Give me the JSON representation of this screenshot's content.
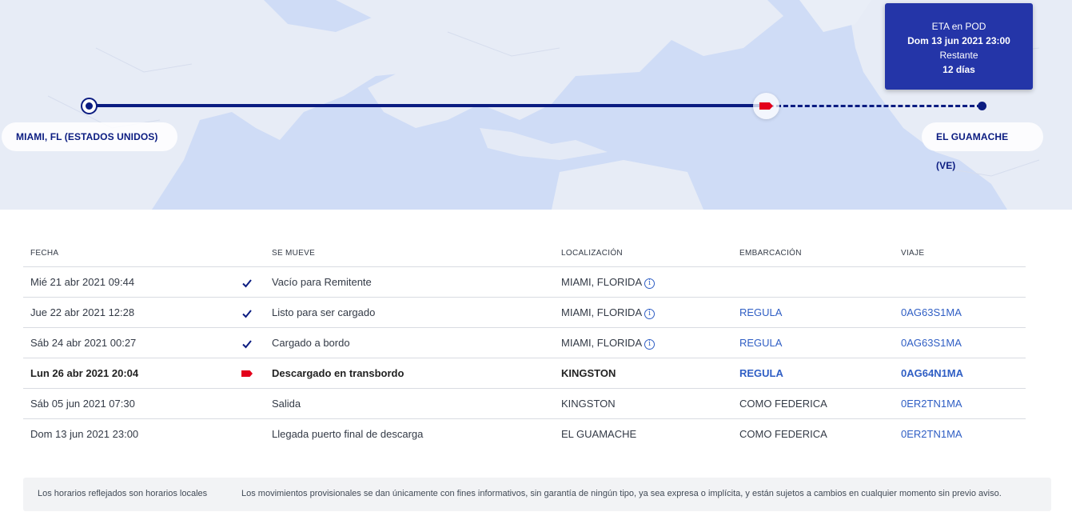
{
  "map": {
    "origin_label": "MIAMI, FL (ESTADOS UNIDOS)",
    "destination_label": "EL GUAMACHE (VE)",
    "eta": {
      "title": "ETA en POD",
      "datetime": "Dom 13 jun 2021 23:00",
      "remaining_label": "Restante",
      "remaining_value": "12 días"
    },
    "colors": {
      "route": "#0b1c81",
      "vessel": "#e3001b",
      "eta_box": "#2435a8",
      "sea": "#d3dff7"
    }
  },
  "table": {
    "headers": {
      "date": "FECHA",
      "move": "SE MUEVE",
      "location": "LOCALIZACIÓN",
      "vessel": "EMBARCACIÓN",
      "voyage": "VIAJE"
    },
    "rows": [
      {
        "date": "Mié 21 abr 2021 09:44",
        "status_icon": "check-icon",
        "move": "Vacío para Remitente",
        "location": "MIAMI, FLORIDA",
        "vessel": "",
        "voyage": ""
      },
      {
        "date": "Jue 22 abr 2021 12:28",
        "status_icon": "check-icon",
        "move": "Listo para ser cargado",
        "location": "MIAMI, FLORIDA",
        "vessel": "REGULA",
        "voyage": "0AG63S1MA"
      },
      {
        "date": "Sáb 24 abr 2021 00:27",
        "status_icon": "check-icon",
        "move": "Cargado a bordo",
        "location": "MIAMI, FLORIDA",
        "vessel": "REGULA",
        "voyage": "0AG63S1MA"
      },
      {
        "date": "Lun 26 abr 2021 20:04",
        "status_icon": "vessel-flag-icon",
        "move": "Descargado en transbordo",
        "location": "KINGSTON",
        "vessel": "REGULA",
        "voyage": "0AG64N1MA"
      },
      {
        "date": "Sáb 05 jun 2021 07:30",
        "status_icon": "",
        "move": "Salida",
        "location": "KINGSTON",
        "vessel": "COMO FEDERICA",
        "voyage": "0ER2TN1MA"
      },
      {
        "date": "Dom 13 jun 2021 23:00",
        "status_icon": "",
        "move": "Llegada puerto final de descarga",
        "location": "EL GUAMACHE",
        "vessel": "COMO FEDERICA",
        "voyage": "0ER2TN1MA"
      }
    ]
  },
  "footer": {
    "note_local_times": "Los horarios reflejados son horarios locales",
    "disclaimer": "Los movimientos provisionales se dan únicamente con fines informativos, sin garantía de ningún tipo, ya sea expresa o implícita, y están sujetos a cambios en cualquier momento sin previo aviso."
  }
}
